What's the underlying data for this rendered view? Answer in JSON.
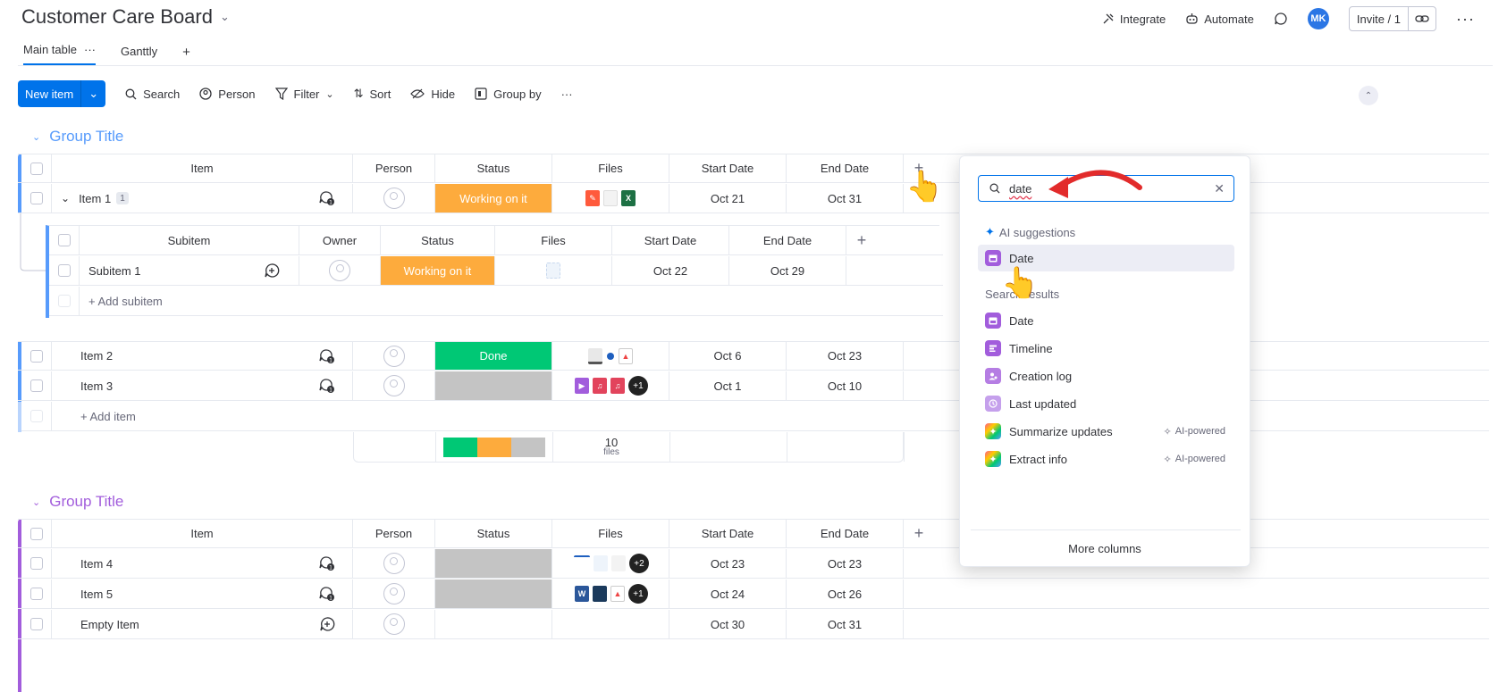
{
  "board": {
    "title": "Customer Care Board",
    "views": [
      {
        "label": "Main table",
        "active": true
      },
      {
        "label": "Ganttly",
        "active": false
      }
    ],
    "view_more": "···",
    "add_view": "+"
  },
  "top_actions": {
    "integrate": "Integrate",
    "automate": "Automate",
    "avatar": "MK",
    "invite": "Invite / 1",
    "more": "···"
  },
  "toolbar": {
    "new_item": "New item",
    "search": "Search",
    "person": "Person",
    "filter": "Filter",
    "sort": "Sort",
    "hide": "Hide",
    "group_by": "Group by",
    "more": "···"
  },
  "colors": {
    "accent": "#0073ea",
    "group1": "#579bfc",
    "group2": "#a25ddc",
    "working": "#fdab3d",
    "done": "#00c875",
    "empty": "#c4c4c4"
  },
  "columns": {
    "item": "Item",
    "person": "Person",
    "status": "Status",
    "files": "Files",
    "start": "Start Date",
    "end": "End Date"
  },
  "subcolumns": {
    "subitem": "Subitem",
    "owner": "Owner",
    "status": "Status",
    "files": "Files",
    "start": "Start Date",
    "end": "End Date"
  },
  "group1": {
    "title": "Group Title",
    "items": [
      {
        "name": "Item 1",
        "count": "1",
        "status": "Working on it",
        "start": "Oct 21",
        "end": "Oct 31"
      },
      {
        "name": "Item 2",
        "status": "Done",
        "start": "Oct 6",
        "end": "Oct 23"
      },
      {
        "name": "Item 3",
        "status": "",
        "start": "Oct 1",
        "end": "Oct 10",
        "more_files": "+1"
      }
    ],
    "subitem": {
      "name": "Subitem 1",
      "status": "Working on it",
      "start": "Oct 22",
      "end": "Oct 29"
    },
    "add_subitem": "+ Add subitem",
    "add_item": "+ Add item",
    "summary_files": "10",
    "summary_files_label": "files",
    "status_summary": {
      "done": 0.33,
      "working": 0.33,
      "empty": 0.34
    }
  },
  "group2": {
    "title": "Group Title",
    "items": [
      {
        "name": "Item 4",
        "status": "",
        "start": "Oct 23",
        "end": "Oct 23",
        "more_files": "+2"
      },
      {
        "name": "Item 5",
        "status": "",
        "start": "Oct 24",
        "end": "Oct 26",
        "more_files": "+1"
      },
      {
        "name": "Empty Item",
        "status": "",
        "start": "Oct 30",
        "end": "Oct 31"
      }
    ]
  },
  "dropdown": {
    "search_value": "date",
    "ai_label": "AI suggestions",
    "ai_items": [
      {
        "label": "Date",
        "icon": "calendar-icon",
        "color": "#a25ddc"
      }
    ],
    "results_label": "Search results",
    "results": [
      {
        "label": "Date",
        "icon": "calendar-icon",
        "color": "#a25ddc"
      },
      {
        "label": "Timeline",
        "icon": "timeline-icon",
        "color": "#a25ddc"
      },
      {
        "label": "Creation log",
        "icon": "creation-log-icon",
        "color": "#b57de3"
      },
      {
        "label": "Last updated",
        "icon": "last-updated-icon",
        "color": "#c5a0ec"
      },
      {
        "label": "Summarize updates",
        "icon": "sparkle-icon",
        "ai": "AI-powered"
      },
      {
        "label": "Extract info",
        "icon": "sparkle-icon",
        "ai": "AI-powered"
      }
    ],
    "more_columns": "More columns"
  }
}
